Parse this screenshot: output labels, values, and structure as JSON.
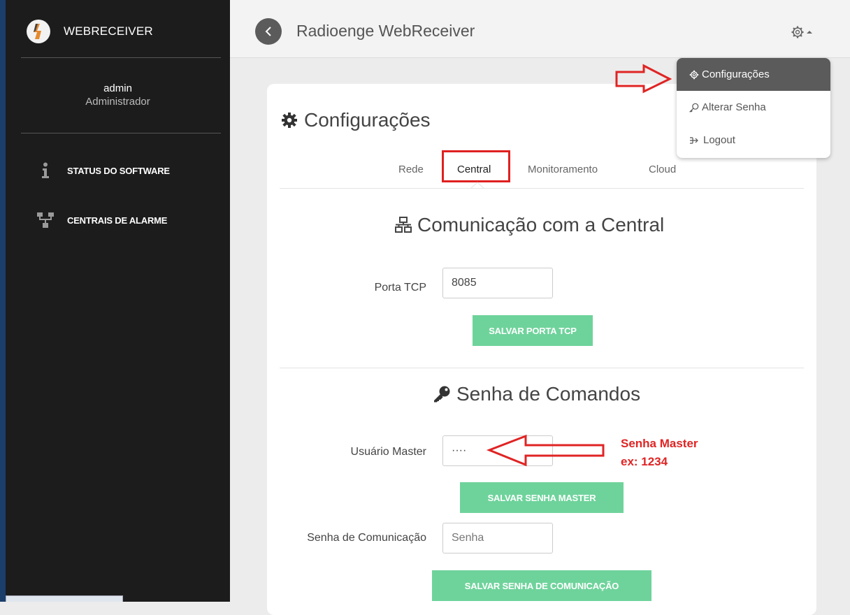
{
  "sidebar": {
    "brand": "WEBRECEIVER",
    "user": {
      "name": "admin",
      "role": "Administrador"
    },
    "items": [
      {
        "label": "STATUS DO SOFTWARE",
        "icon": "info-icon"
      },
      {
        "label": "CENTRAIS DE ALARME",
        "icon": "network-icon"
      }
    ]
  },
  "header": {
    "title": "Radioenge WebReceiver",
    "settings_icon": "gear-icon"
  },
  "menu": {
    "items": [
      {
        "label": "Configurações",
        "icon": "gear-icon",
        "active": true
      },
      {
        "label": "Alterar Senha",
        "icon": "key-icon"
      },
      {
        "label": "Logout",
        "icon": "logout-icon"
      }
    ]
  },
  "page": {
    "title": "Configurações",
    "tabs": [
      {
        "label": "Rede"
      },
      {
        "label": "Central",
        "active": true
      },
      {
        "label": "Monitoramento"
      },
      {
        "label": "Cloud"
      }
    ],
    "communication": {
      "title": "Comunicação com a Central",
      "port_label": "Porta TCP",
      "port_value": "8085",
      "save_port": "SALVAR PORTA TCP"
    },
    "commands": {
      "title": "Senha de Comandos",
      "master_label": "Usuário Master",
      "master_value": "····",
      "save_master": "SALVAR SENHA MASTER",
      "comm_label": "Senha de Comunicação",
      "comm_placeholder": "Senha",
      "save_comm": "SALVAR SENHA DE COMUNICAÇÃO"
    }
  },
  "annotation": {
    "line1": "Senha Master",
    "line2": "ex: 1234"
  },
  "colors": {
    "sidebar_bg": "#1c1c1c",
    "accent_green": "#6ed39b",
    "annotation_red": "#e02424",
    "menu_active": "#5b5b5b"
  }
}
